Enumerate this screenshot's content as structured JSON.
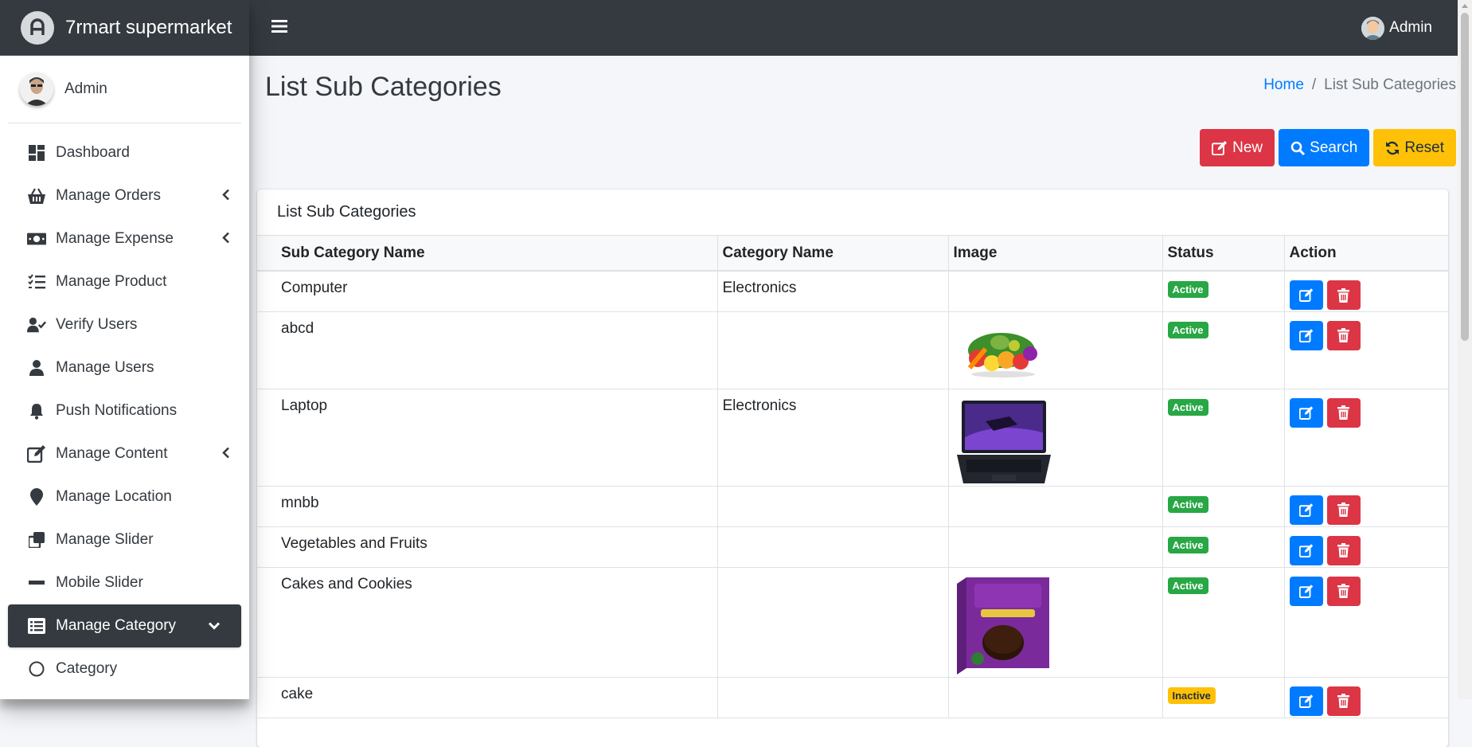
{
  "app": {
    "brand": "7rmart supermarket",
    "top_user": "Admin"
  },
  "sidebar": {
    "user": "Admin",
    "items": [
      {
        "label": "Dashboard",
        "icon": "dashboard-icon"
      },
      {
        "label": "Manage Orders",
        "icon": "basket-icon",
        "has_chevron": true
      },
      {
        "label": "Manage Expense",
        "icon": "money-bill-icon",
        "has_chevron": true
      },
      {
        "label": "Manage Product",
        "icon": "list-check-icon"
      },
      {
        "label": "Verify Users",
        "icon": "user-check-icon"
      },
      {
        "label": "Manage Users",
        "icon": "user-icon"
      },
      {
        "label": "Push Notifications",
        "icon": "bell-icon"
      },
      {
        "label": "Manage Content",
        "icon": "edit-icon",
        "has_chevron": true
      },
      {
        "label": "Manage Location",
        "icon": "map-marker-icon"
      },
      {
        "label": "Manage Slider",
        "icon": "clone-icon"
      },
      {
        "label": "Mobile Slider",
        "icon": "minus-icon"
      },
      {
        "label": "Manage Category",
        "icon": "list-alt-icon",
        "active": true,
        "expanded": true
      },
      {
        "label": "Category",
        "icon": "circle-icon"
      }
    ]
  },
  "page": {
    "title": "List Sub Categories",
    "breadcrumb": {
      "home": "Home",
      "separator": "/",
      "current": "List Sub Categories"
    }
  },
  "toolbar": {
    "new_label": "New",
    "search_label": "Search",
    "reset_label": "Reset"
  },
  "card": {
    "title": "List Sub Categories"
  },
  "table": {
    "headers": [
      "Sub Category Name",
      "Category Name",
      "Image",
      "Status",
      "Action"
    ],
    "rows": [
      {
        "name": "Computer",
        "category": "Electronics",
        "image": "",
        "status": "Active"
      },
      {
        "name": "abcd",
        "category": "",
        "image": "vegetables",
        "status": "Active"
      },
      {
        "name": "Laptop",
        "category": "Electronics",
        "image": "laptop",
        "status": "Active"
      },
      {
        "name": "mnbb",
        "category": "",
        "image": "",
        "status": "Active"
      },
      {
        "name": "Vegetables and Fruits",
        "category": "",
        "image": "",
        "status": "Active"
      },
      {
        "name": "Cakes and Cookies",
        "category": "",
        "image": "dark-fantasy-box",
        "status": "Active"
      },
      {
        "name": "cake",
        "category": "",
        "image": "",
        "status": "Inactive"
      }
    ]
  },
  "colors": {
    "topbar": "#343a40",
    "primary": "#007bff",
    "danger": "#dc3545",
    "warning": "#ffc107",
    "success": "#28a745"
  }
}
